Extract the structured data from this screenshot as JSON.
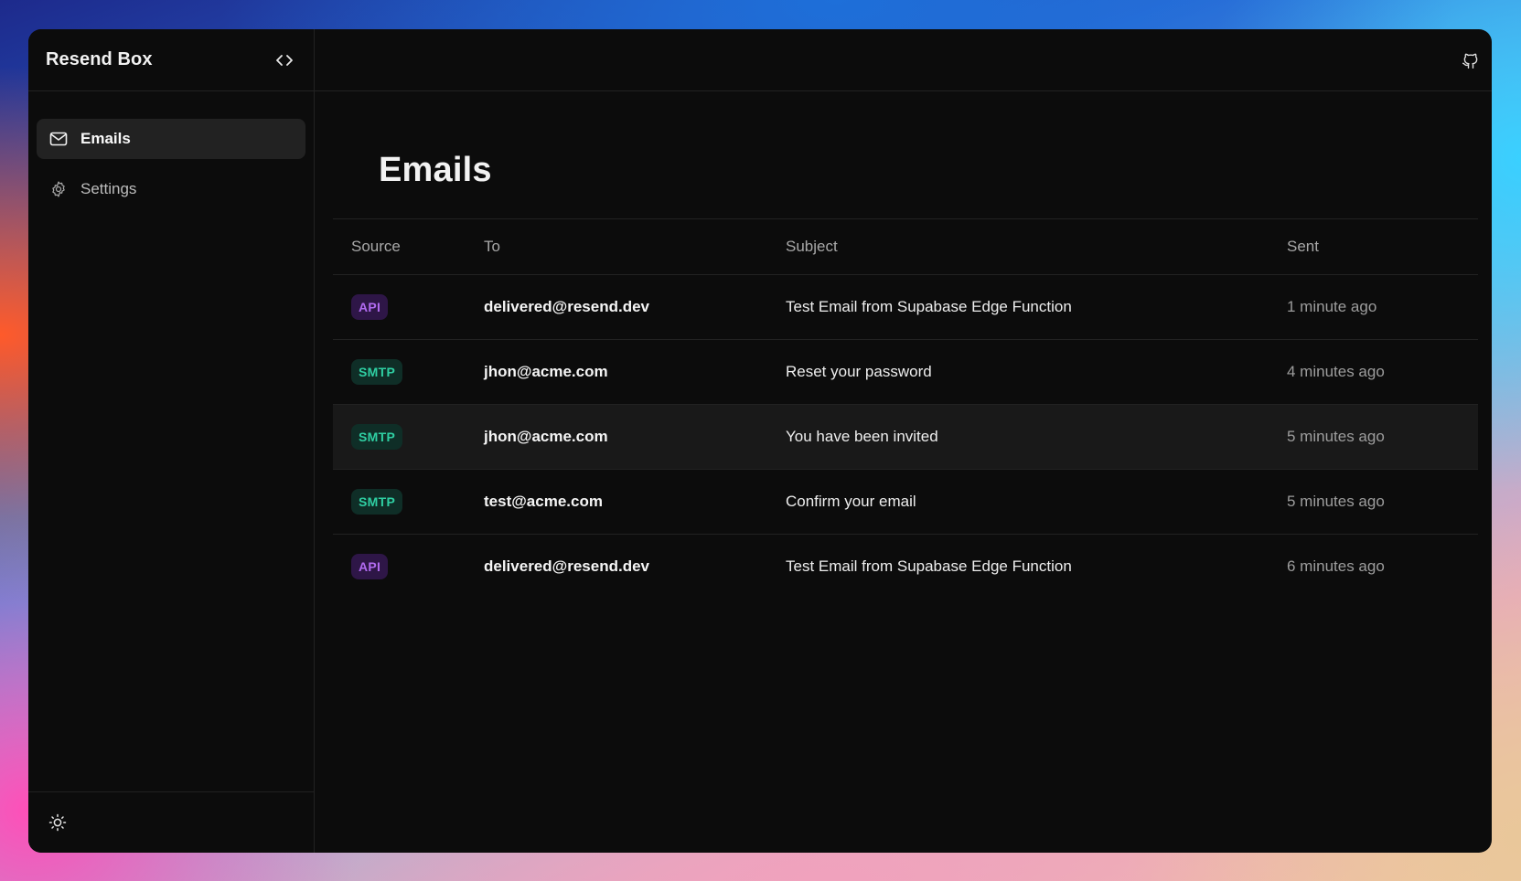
{
  "app": {
    "title": "Resend Box"
  },
  "sidebar": {
    "items": [
      {
        "label": "Emails",
        "icon": "mail-icon",
        "active": true
      },
      {
        "label": "Settings",
        "icon": "gear-icon",
        "active": false
      }
    ],
    "footer_icon": "sun-icon"
  },
  "topbar": {
    "icon": "github-icon"
  },
  "main": {
    "title": "Emails",
    "table": {
      "headers": {
        "source": "Source",
        "to": "To",
        "subject": "Subject",
        "sent": "Sent"
      },
      "rows": [
        {
          "source": "API",
          "to": "delivered@resend.dev",
          "subject": "Test Email from Supabase Edge Function",
          "sent": "1 minute ago"
        },
        {
          "source": "SMTP",
          "to": "jhon@acme.com",
          "subject": "Reset your password",
          "sent": "4 minutes ago"
        },
        {
          "source": "SMTP",
          "to": "jhon@acme.com",
          "subject": "You have been invited",
          "sent": "5 minutes ago"
        },
        {
          "source": "SMTP",
          "to": "test@acme.com",
          "subject": "Confirm your email",
          "sent": "5 minutes ago"
        },
        {
          "source": "API",
          "to": "delivered@resend.dev",
          "subject": "Test Email from Supabase Edge Function",
          "sent": "6 minutes ago"
        }
      ]
    }
  },
  "colors": {
    "window_bg": "#0c0c0c",
    "api_badge_bg": "#2e1647",
    "api_badge_text": "#b16bf0",
    "smtp_badge_bg": "#0f2e27",
    "smtp_badge_text": "#2fcfa3"
  }
}
